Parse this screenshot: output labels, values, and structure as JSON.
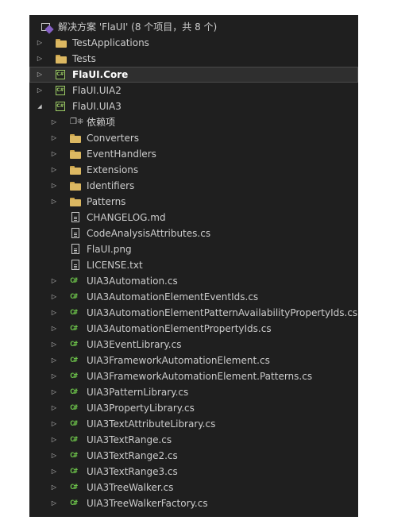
{
  "solution": {
    "label": "解决方案 'FlaUI' (8 个项目，共 8 个)",
    "icon": "solution-icon"
  },
  "rows": [
    {
      "label": "TestApplications",
      "level": 1,
      "arrow": "collapsed",
      "icon": "folder-icon"
    },
    {
      "label": "Tests",
      "level": 1,
      "arrow": "collapsed",
      "icon": "folder-icon"
    },
    {
      "label": "FlaUI.Core",
      "level": 1,
      "arrow": "collapsed",
      "icon": "csharp-project-icon",
      "selected": true,
      "bold": true
    },
    {
      "label": "FlaUI.UIA2",
      "level": 1,
      "arrow": "collapsed",
      "icon": "csharp-project-icon"
    },
    {
      "label": "FlaUI.UIA3",
      "level": 1,
      "arrow": "expanded",
      "icon": "csharp-project-icon"
    },
    {
      "label": "依赖项",
      "level": 2,
      "arrow": "collapsed",
      "icon": "dependencies-icon"
    },
    {
      "label": "Converters",
      "level": 2,
      "arrow": "collapsed",
      "icon": "folder-icon"
    },
    {
      "label": "EventHandlers",
      "level": 2,
      "arrow": "collapsed",
      "icon": "folder-icon"
    },
    {
      "label": "Extensions",
      "level": 2,
      "arrow": "collapsed",
      "icon": "folder-icon"
    },
    {
      "label": "Identifiers",
      "level": 2,
      "arrow": "collapsed",
      "icon": "folder-icon"
    },
    {
      "label": "Patterns",
      "level": 2,
      "arrow": "collapsed",
      "icon": "folder-icon"
    },
    {
      "label": "CHANGELOG.md",
      "level": 2,
      "arrow": "none",
      "icon": "document-icon"
    },
    {
      "label": "CodeAnalysisAttributes.cs",
      "level": 2,
      "arrow": "none",
      "icon": "document-icon"
    },
    {
      "label": "FlaUI.png",
      "level": 2,
      "arrow": "none",
      "icon": "document-icon"
    },
    {
      "label": "LICENSE.txt",
      "level": 2,
      "arrow": "none",
      "icon": "document-icon"
    },
    {
      "label": "UIA3Automation.cs",
      "level": 2,
      "arrow": "collapsed",
      "icon": "csharp-file-icon"
    },
    {
      "label": "UIA3AutomationElementEventIds.cs",
      "level": 2,
      "arrow": "collapsed",
      "icon": "csharp-file-icon"
    },
    {
      "label": "UIA3AutomationElementPatternAvailabilityPropertyIds.cs",
      "level": 2,
      "arrow": "collapsed",
      "icon": "csharp-file-icon"
    },
    {
      "label": "UIA3AutomationElementPropertyIds.cs",
      "level": 2,
      "arrow": "collapsed",
      "icon": "csharp-file-icon"
    },
    {
      "label": "UIA3EventLibrary.cs",
      "level": 2,
      "arrow": "collapsed",
      "icon": "csharp-file-icon"
    },
    {
      "label": "UIA3FrameworkAutomationElement.cs",
      "level": 2,
      "arrow": "collapsed",
      "icon": "csharp-file-icon"
    },
    {
      "label": "UIA3FrameworkAutomationElement.Patterns.cs",
      "level": 2,
      "arrow": "collapsed",
      "icon": "csharp-file-icon"
    },
    {
      "label": "UIA3PatternLibrary.cs",
      "level": 2,
      "arrow": "collapsed",
      "icon": "csharp-file-icon"
    },
    {
      "label": "UIA3PropertyLibrary.cs",
      "level": 2,
      "arrow": "collapsed",
      "icon": "csharp-file-icon"
    },
    {
      "label": "UIA3TextAttributeLibrary.cs",
      "level": 2,
      "arrow": "collapsed",
      "icon": "csharp-file-icon"
    },
    {
      "label": "UIA3TextRange.cs",
      "level": 2,
      "arrow": "collapsed",
      "icon": "csharp-file-icon"
    },
    {
      "label": "UIA3TextRange2.cs",
      "level": 2,
      "arrow": "collapsed",
      "icon": "csharp-file-icon"
    },
    {
      "label": "UIA3TextRange3.cs",
      "level": 2,
      "arrow": "collapsed",
      "icon": "csharp-file-icon"
    },
    {
      "label": "UIA3TreeWalker.cs",
      "level": 2,
      "arrow": "collapsed",
      "icon": "csharp-file-icon"
    },
    {
      "label": "UIA3TreeWalkerFactory.cs",
      "level": 2,
      "arrow": "collapsed",
      "icon": "csharp-file-icon"
    }
  ],
  "colors": {
    "panel_background": "#1f1f1f",
    "text": "#cccccc",
    "selected_background": "#2f2f2f",
    "csharp_green": "#6cc24a",
    "folder_yellow": "#dcb862"
  }
}
